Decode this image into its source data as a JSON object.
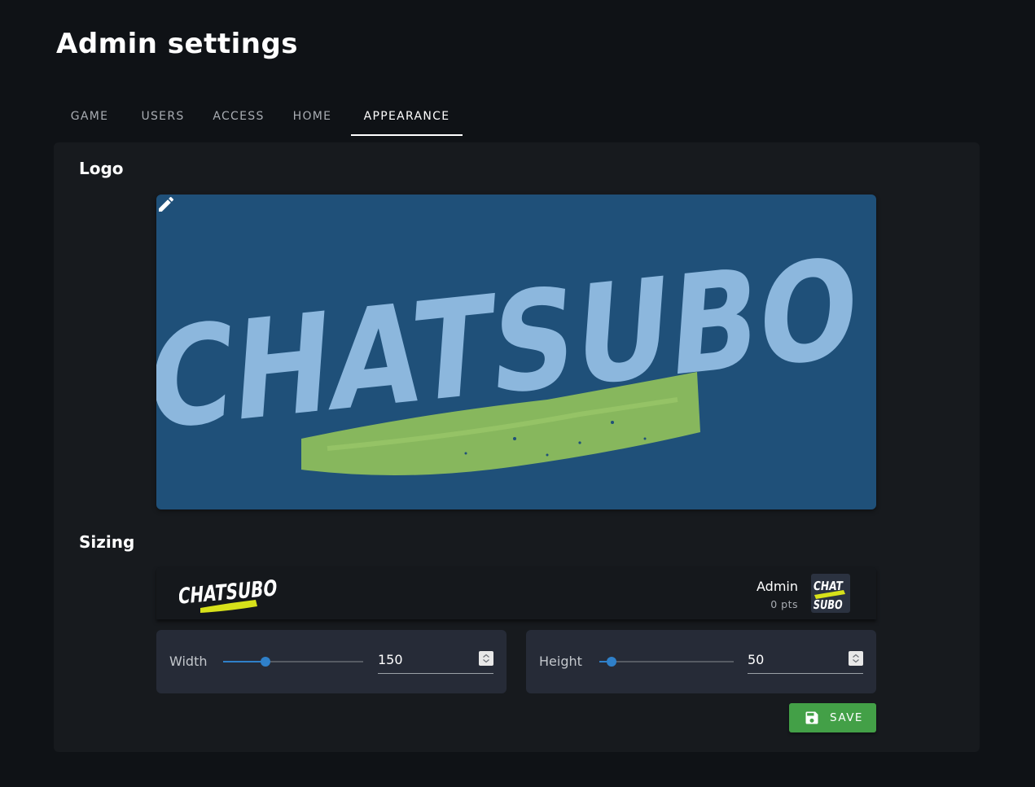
{
  "page": {
    "title": "Admin settings"
  },
  "tabs": [
    {
      "label": "GAME",
      "active": false
    },
    {
      "label": "USERS",
      "active": false
    },
    {
      "label": "ACCESS",
      "active": false
    },
    {
      "label": "HOME",
      "active": false
    },
    {
      "label": "APPEARANCE",
      "active": true
    }
  ],
  "logo_section": {
    "title": "Logo",
    "logo_text": "CHATSUBO",
    "icon": "pencil-icon",
    "colors": {
      "background": "#1f5079",
      "letters": "#8cb7dd",
      "brush": "#8dbd5c"
    }
  },
  "sizing_section": {
    "title": "Sizing",
    "preview": {
      "logo_text": "CHATSUBO",
      "avatar_text_top": "CHAT",
      "avatar_text_bottom": "SUBO",
      "user_name": "Admin",
      "user_points": "0 pts"
    },
    "width": {
      "label": "Width",
      "value": "150",
      "slider_fraction": 0.3
    },
    "height": {
      "label": "Height",
      "value": "50",
      "slider_fraction": 0.09
    }
  },
  "actions": {
    "save_label": "SAVE",
    "save_icon": "floppy-disk-icon",
    "save_color": "#43a047"
  }
}
